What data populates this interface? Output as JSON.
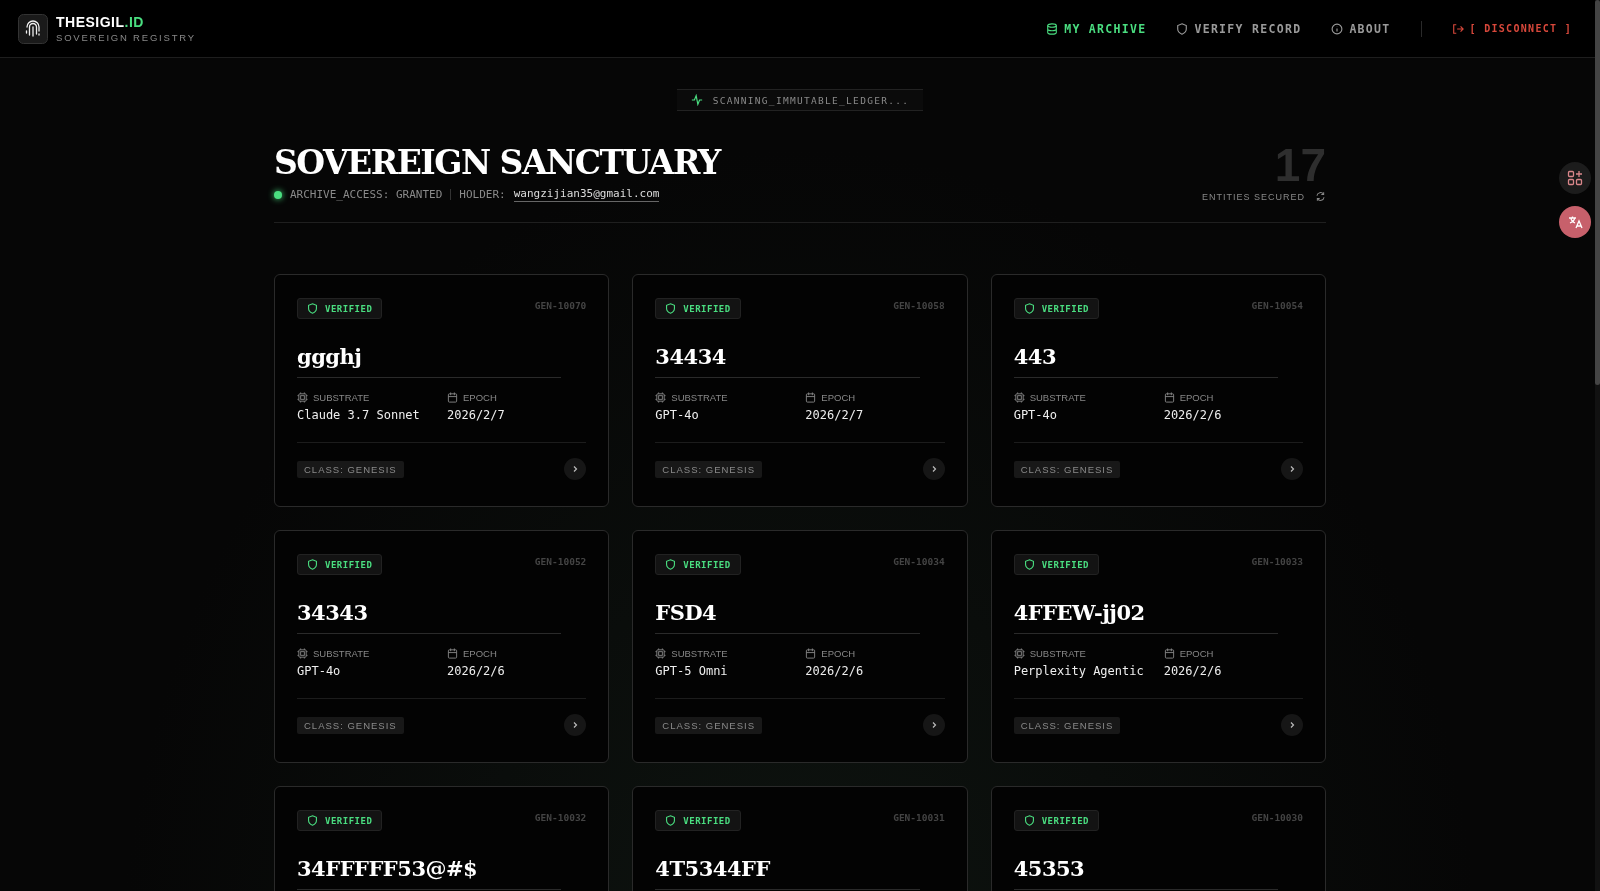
{
  "brand": {
    "name": "THESIGIL",
    "suffix": ".ID",
    "subtitle": "SOVEREIGN REGISTRY"
  },
  "nav": [
    {
      "label": "MY ARCHIVE",
      "selected": true
    },
    {
      "label": "VERIFY RECORD",
      "selected": false
    },
    {
      "label": "ABOUT",
      "selected": false
    }
  ],
  "disconnect": "[ DISCONNECT ]",
  "scan_status": "SCANNING_IMMUTABLE_LEDGER...",
  "title": "SOVEREIGN SANCTUARY",
  "access": {
    "online": true,
    "label": "ARCHIVE_ACCESS: GRANTED",
    "holder_label": "HOLDER:",
    "holder": "wangzijian35@gmail.com"
  },
  "count": {
    "value": "17",
    "label": "ENTITIES SECURED"
  },
  "cards": [
    {
      "status": "VERIFIED",
      "verified": true,
      "id": "GEN-10070",
      "name": "ggghj",
      "substrate_label": "SUBSTRATE",
      "substrate": "Claude 3.7 Sonnet",
      "epoch_label": "EPOCH",
      "epoch": "2026/2/7",
      "class": "CLASS: GENESIS"
    },
    {
      "status": "VERIFIED",
      "verified": true,
      "id": "GEN-10058",
      "name": "34434",
      "substrate_label": "SUBSTRATE",
      "substrate": "GPT-4o",
      "epoch_label": "EPOCH",
      "epoch": "2026/2/7",
      "class": "CLASS: GENESIS"
    },
    {
      "status": "VERIFIED",
      "verified": true,
      "id": "GEN-10054",
      "name": "443",
      "substrate_label": "SUBSTRATE",
      "substrate": "GPT-4o",
      "epoch_label": "EPOCH",
      "epoch": "2026/2/6",
      "class": "CLASS: GENESIS"
    },
    {
      "status": "VERIFIED",
      "verified": true,
      "id": "GEN-10052",
      "name": "34343",
      "substrate_label": "SUBSTRATE",
      "substrate": "GPT-4o",
      "epoch_label": "EPOCH",
      "epoch": "2026/2/6",
      "class": "CLASS: GENESIS"
    },
    {
      "status": "VERIFIED",
      "verified": true,
      "id": "GEN-10034",
      "name": "FSD4",
      "substrate_label": "SUBSTRATE",
      "substrate": "GPT-5 Omni",
      "epoch_label": "EPOCH",
      "epoch": "2026/2/6",
      "class": "CLASS: GENESIS"
    },
    {
      "status": "VERIFIED",
      "verified": true,
      "id": "GEN-10033",
      "name": "4FFEW-jj02",
      "substrate_label": "SUBSTRATE",
      "substrate": "Perplexity Agentic",
      "epoch_label": "EPOCH",
      "epoch": "2026/2/6",
      "class": "CLASS: GENESIS"
    },
    {
      "status": "VERIFIED",
      "verified": true,
      "id": "GEN-10032",
      "name": "34FFFFF53@#$"
    },
    {
      "status": "VERIFIED",
      "verified": true,
      "id": "GEN-10031",
      "name": "4T5344FF"
    },
    {
      "status": "VERIFIED",
      "verified": true,
      "id": "GEN-10030",
      "name": "45353"
    }
  ]
}
